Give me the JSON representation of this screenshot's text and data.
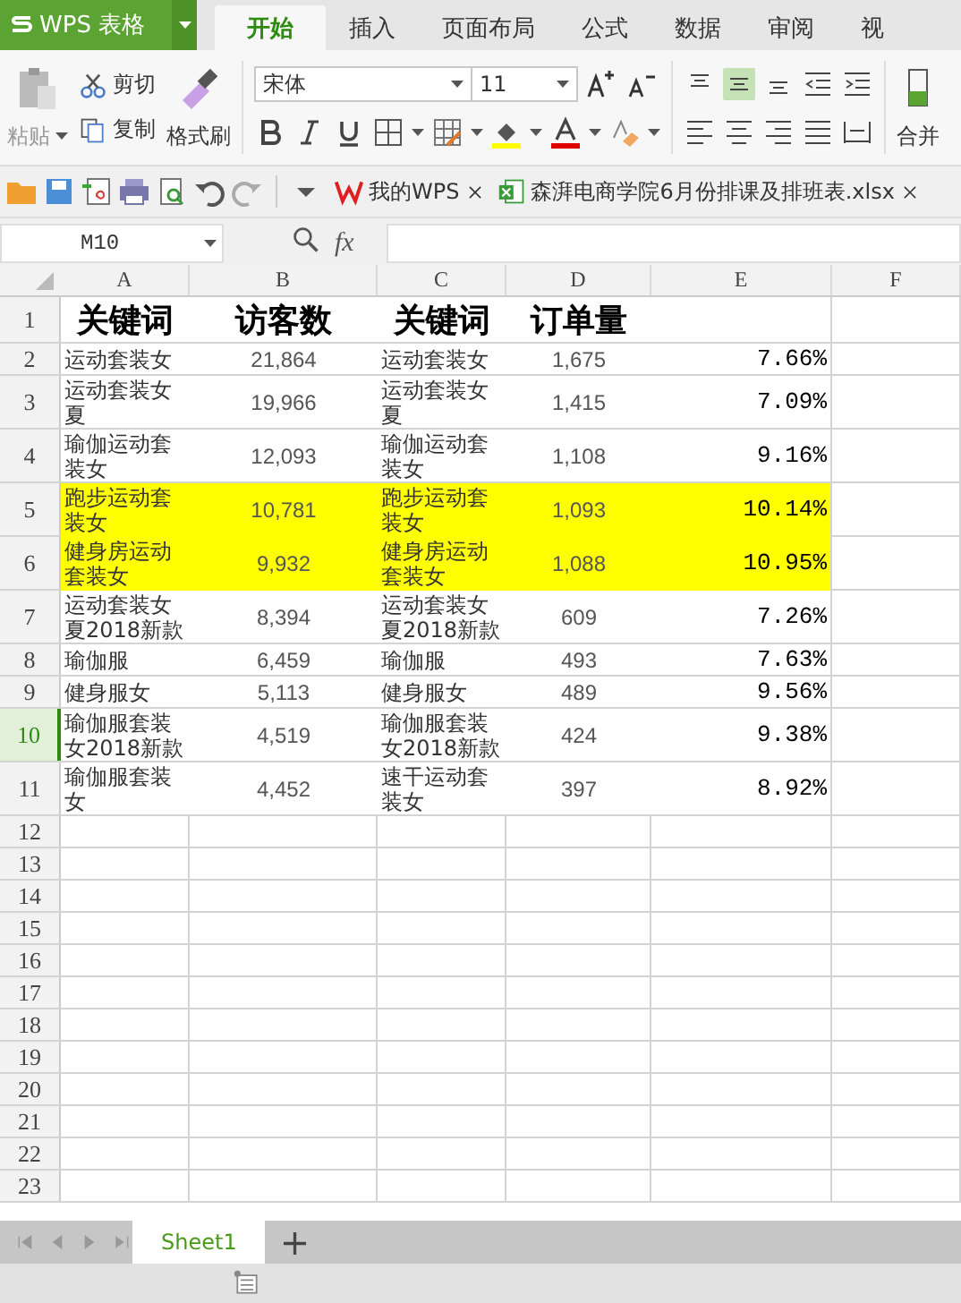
{
  "app": {
    "logo": "WPS 表格"
  },
  "tabs": [
    {
      "label": "开始",
      "selected": true
    },
    {
      "label": "插入",
      "selected": false
    },
    {
      "label": "页面布局",
      "selected": false
    },
    {
      "label": "公式",
      "selected": false
    },
    {
      "label": "数据",
      "selected": false
    },
    {
      "label": "审阅",
      "selected": false
    },
    {
      "label": "视",
      "selected": false
    }
  ],
  "ribbon": {
    "paste": {
      "label": "粘贴",
      "disabled": true
    },
    "cut": "剪切",
    "copy": "复制",
    "format_painter": "格式刷",
    "font": "宋体",
    "font_size": "11",
    "merge": "合并",
    "vertical_align": [
      {
        "selected": false
      },
      {
        "selected": true
      },
      {
        "selected": false
      }
    ]
  },
  "doc_tabs": [
    {
      "label": "我的WPS",
      "kind": "home"
    },
    {
      "label": "森湃电商学院6月份排课及排班表.xlsx",
      "kind": "sheet"
    }
  ],
  "formula_bar": {
    "name_box": "M10",
    "fx": "fx"
  },
  "sheet": {
    "columns": [
      "A",
      "B",
      "C",
      "D",
      "E",
      "F"
    ],
    "rows": [
      {
        "number": "1",
        "kind": "header",
        "selected": false,
        "cells": [
          "关键词",
          "访客数",
          "关键词",
          "订单量",
          ""
        ]
      },
      {
        "number": "2",
        "kind": "data",
        "selected": false,
        "highlighted": false,
        "cells": [
          "运动套装女",
          "21,864",
          "运动套装女",
          "1,675",
          "7.66%"
        ]
      },
      {
        "number": "3",
        "kind": "data",
        "selected": false,
        "highlighted": false,
        "cells": [
          "运动套装女夏",
          "19,966",
          "运动套装女夏",
          "1,415",
          "7.09%"
        ]
      },
      {
        "number": "4",
        "kind": "data",
        "selected": false,
        "highlighted": false,
        "cells": [
          "瑜伽运动套装女",
          "12,093",
          "瑜伽运动套装女",
          "1,108",
          "9.16%"
        ]
      },
      {
        "number": "5",
        "kind": "data",
        "selected": false,
        "highlighted": true,
        "cells": [
          "跑步运动套装女",
          "10,781",
          "跑步运动套装女",
          "1,093",
          "10.14%"
        ]
      },
      {
        "number": "6",
        "kind": "data",
        "selected": false,
        "highlighted": true,
        "cells": [
          "健身房运动套装女",
          "9,932",
          "健身房运动套装女",
          "1,088",
          "10.95%"
        ]
      },
      {
        "number": "7",
        "kind": "data",
        "selected": false,
        "highlighted": false,
        "cells": [
          "运动套装女夏2018新款",
          "8,394",
          "运动套装女夏2018新款",
          "609",
          "7.26%"
        ]
      },
      {
        "number": "8",
        "kind": "data",
        "selected": false,
        "highlighted": false,
        "cells": [
          "瑜伽服",
          "6,459",
          "瑜伽服",
          "493",
          "7.63%"
        ]
      },
      {
        "number": "9",
        "kind": "data",
        "selected": false,
        "highlighted": false,
        "cells": [
          "健身服女",
          "5,113",
          "健身服女",
          "489",
          "9.56%"
        ]
      },
      {
        "number": "10",
        "kind": "data",
        "selected": true,
        "highlighted": false,
        "cells": [
          "瑜伽服套装女2018新款",
          "4,519",
          "瑜伽服套装女2018新款",
          "424",
          "9.38%"
        ]
      },
      {
        "number": "11",
        "kind": "data",
        "selected": false,
        "highlighted": false,
        "cells": [
          "瑜伽服套装女",
          "4,452",
          "速干运动套装女",
          "397",
          "8.92%"
        ]
      }
    ],
    "empty_rows": [
      "12",
      "13",
      "14",
      "15",
      "16",
      "17",
      "18",
      "19",
      "20",
      "21",
      "22",
      "23"
    ]
  },
  "sheet_tabs": [
    {
      "label": "Sheet1",
      "selected": true
    }
  ],
  "add_sheet": "+"
}
